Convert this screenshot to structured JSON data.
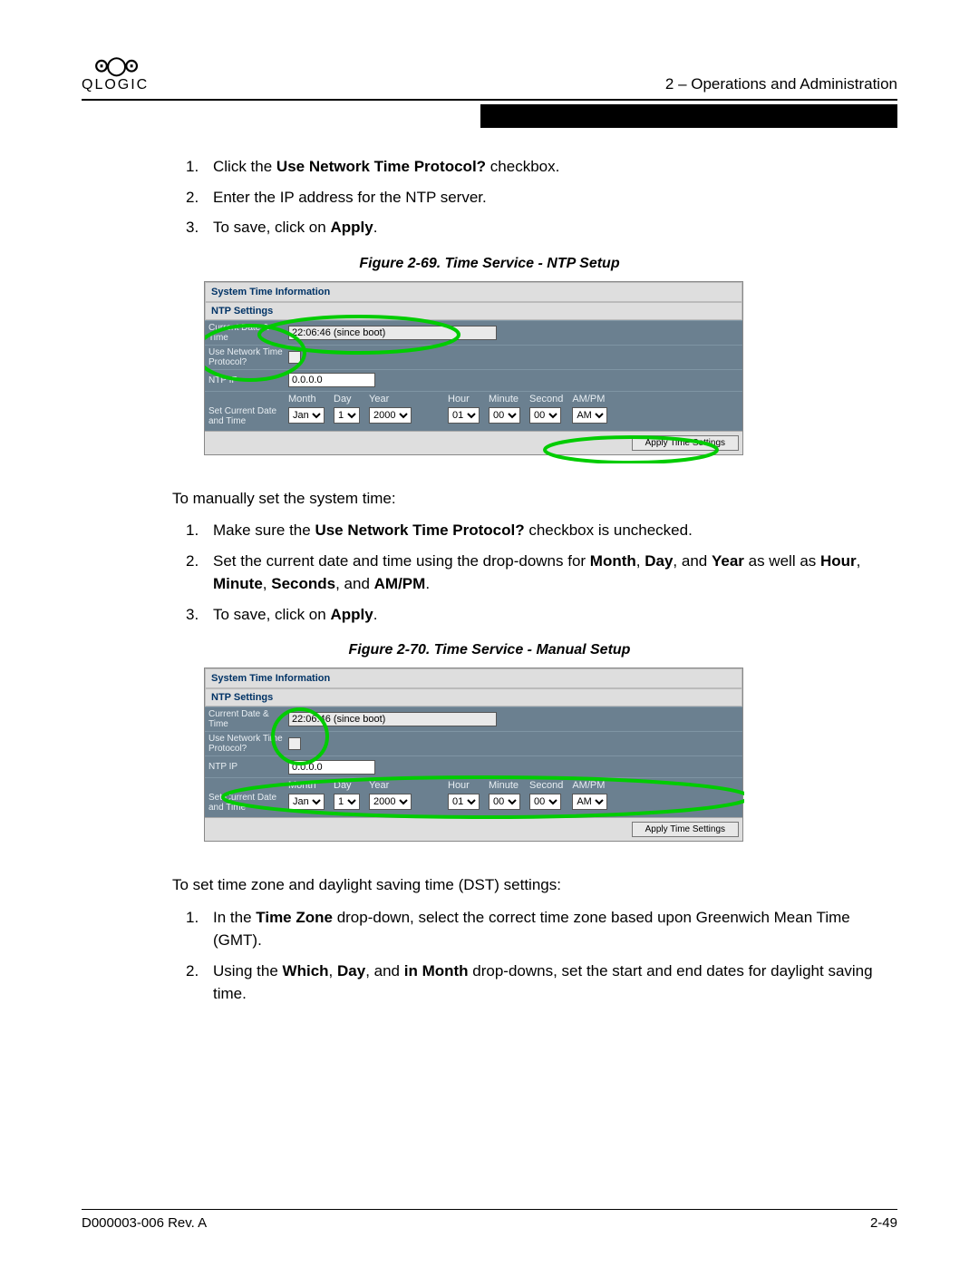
{
  "header": {
    "logo_name": "QLOGIC",
    "chapter": "2 – Operations and Administration"
  },
  "section1": {
    "steps": [
      {
        "n": "1.",
        "pre": "Click the ",
        "bold": "Use Network Time Protocol?",
        "post": " checkbox."
      },
      {
        "n": "2.",
        "pre": "Enter the IP address for the NTP server.",
        "bold": "",
        "post": ""
      },
      {
        "n": "3.",
        "pre": "To save, click on ",
        "bold": "Apply",
        "post": "."
      }
    ]
  },
  "fig1": {
    "caption": "Figure 2-69. Time Service - NTP Setup",
    "panel_title1": "System Time Information",
    "panel_title2": "NTP Settings",
    "current_lbl": "Current Date & Time",
    "current_val": "22:06:46 (since boot)",
    "usenet_lbl": "Use Network Time Protocol?",
    "ntpip_lbl": "NTP IP",
    "ntpip_val": "0.0.0.0",
    "setdate_lbl": "Set Current Date and Time",
    "hdr": {
      "month": "Month",
      "day": "Day",
      "year": "Year",
      "hour": "Hour",
      "minute": "Minute",
      "second": "Second",
      "ampm": "AM/PM"
    },
    "vals": {
      "month": "Jan",
      "day": "1",
      "year": "2000",
      "hour": "01",
      "minute": "00",
      "second": "00",
      "ampm": "AM"
    },
    "apply": "Apply Time Settings"
  },
  "mid": {
    "intro": "To manually set the system time:",
    "steps": [
      {
        "n": "1.",
        "html": "Make sure the <b>Use Network Time Protocol?</b> checkbox is unchecked."
      },
      {
        "n": "2.",
        "html": "Set the current date and time using the drop-downs for <b>Month</b>, <b>Day</b>, and <b>Year</b> as well as <b>Hour</b>, <b>Minute</b>, <b>Seconds</b>, and <b>AM/PM</b>."
      },
      {
        "n": "3.",
        "html": "To save, click on <b>Apply</b>."
      }
    ]
  },
  "fig2": {
    "caption": "Figure 2-70. Time Service - Manual Setup",
    "panel_title1": "System Time Information",
    "panel_title2": "NTP Settings",
    "current_lbl": "Current Date & Time",
    "current_val": "22:06:46 (since boot)",
    "usenet_lbl": "Use Network Time Protocol?",
    "ntpip_lbl": "NTP IP",
    "ntpip_val": "0.0.0.0",
    "setdate_lbl": "Set Current Date and Time",
    "hdr": {
      "month": "Month",
      "day": "Day",
      "year": "Year",
      "hour": "Hour",
      "minute": "Minute",
      "second": "Second",
      "ampm": "AM/PM"
    },
    "vals": {
      "month": "Jan",
      "day": "1",
      "year": "2000",
      "hour": "01",
      "minute": "00",
      "second": "00",
      "ampm": "AM"
    },
    "apply": "Apply Time Settings"
  },
  "tz": {
    "intro": "To set time zone and daylight saving time (DST) settings:",
    "steps": [
      {
        "n": "1.",
        "html": "In the <b>Time Zone</b> drop-down, select the correct time zone based upon Greenwich Mean Time (GMT)."
      },
      {
        "n": "2.",
        "html": "Using the <b>Which</b>, <b>Day</b>, and <b>in Month</b> drop-downs, set the start and end dates for daylight saving time."
      }
    ]
  },
  "footer": {
    "doc": "D000003-006 Rev. A",
    "page": "2-49"
  }
}
